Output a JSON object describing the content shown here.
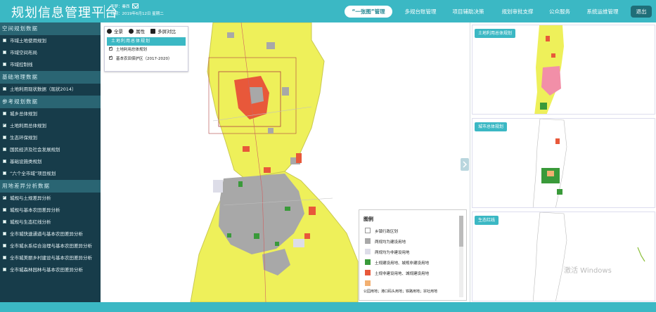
{
  "header": {
    "title": "规划信息管理平台",
    "user_line": "李梦：秦西",
    "date_line": "日期：2019年6月12日 星期二",
    "nav": [
      "“一张图”管理",
      "多规台账管理",
      "项目辅助决策",
      "规划审批支撑",
      "公众服务",
      "系统运维管理"
    ],
    "logout": "退出"
  },
  "sidebar": {
    "sections": [
      {
        "title": "空间规划数据",
        "items": [
          {
            "label": "市域土地使用规划",
            "checked": false
          },
          {
            "label": "市域空间布局",
            "checked": false
          },
          {
            "label": "市域控制线",
            "checked": false
          }
        ]
      },
      {
        "title": "基础地理数据",
        "items": [
          {
            "label": "土地利用现状数据（现状2014）",
            "checked": false
          }
        ]
      },
      {
        "title": "参考规划数据",
        "items": [
          {
            "label": "城乡总体规划",
            "checked": false
          },
          {
            "label": "土地利用总体规划",
            "checked": true
          },
          {
            "label": "生态环保规划",
            "checked": false
          },
          {
            "label": "国民经济及社会发展规划",
            "checked": false
          },
          {
            "label": "基础设施类规划",
            "checked": false
          },
          {
            "label": "“六个全市域”项目规划",
            "checked": false
          }
        ]
      },
      {
        "title": "用地差异分析数据",
        "items": [
          {
            "label": "城规与土规差异分析",
            "checked": true
          },
          {
            "label": "城规与基本农田差异分析",
            "checked": false
          },
          {
            "label": "城规与生态红线分析",
            "checked": false
          },
          {
            "label": "全市城快速通道与基本农田差异分析",
            "checked": false
          },
          {
            "label": "全市城水系综合治理与基本农田差异分析",
            "checked": false
          },
          {
            "label": "全市城美丽乡村建设与基本农田差异分析",
            "checked": false
          },
          {
            "label": "全市城森林园林与基本农田差异分析",
            "checked": false
          }
        ]
      }
    ]
  },
  "map": {
    "tools": [
      "全景",
      "属性",
      "多屏对比"
    ],
    "layer_panel": {
      "title": "土地利用总体规划",
      "items": [
        {
          "label": "土地利用总体规划",
          "checked": true
        },
        {
          "label": "基本农田保护区（2017-2020）",
          "checked": true
        }
      ]
    },
    "legend": {
      "title": "图例",
      "items": [
        {
          "label": "乡镇行政区划",
          "color": "#ffffff"
        },
        {
          "label": "两规均为建设用地",
          "color": "#a8a8a8"
        },
        {
          "label": "两规均为非建设用地",
          "color": "#dddde8"
        },
        {
          "label": "土规建设用地、城规非建设用地",
          "color": "#3a9a3a"
        },
        {
          "label": "土规非建设用地、城规建设用地",
          "color": "#e8583a"
        },
        {
          "label": "",
          "color": "#f2b071"
        }
      ],
      "extra_text": "公园用地；港口码头用地；铁路用地；宗社用地"
    }
  },
  "right_panels": [
    {
      "label": "土地利用总体规划"
    },
    {
      "label": "城市总体规划"
    },
    {
      "label": "生态红线"
    }
  ],
  "watermark": "激活 Windows",
  "colors": {
    "header": "#3bb8c4",
    "sidebar": "#173c4a",
    "section_header": "#2a6573",
    "map_yellow": "#eef05a",
    "map_gray": "#a8a8a8",
    "map_red": "#e8583a",
    "map_green": "#3a9a3a"
  }
}
